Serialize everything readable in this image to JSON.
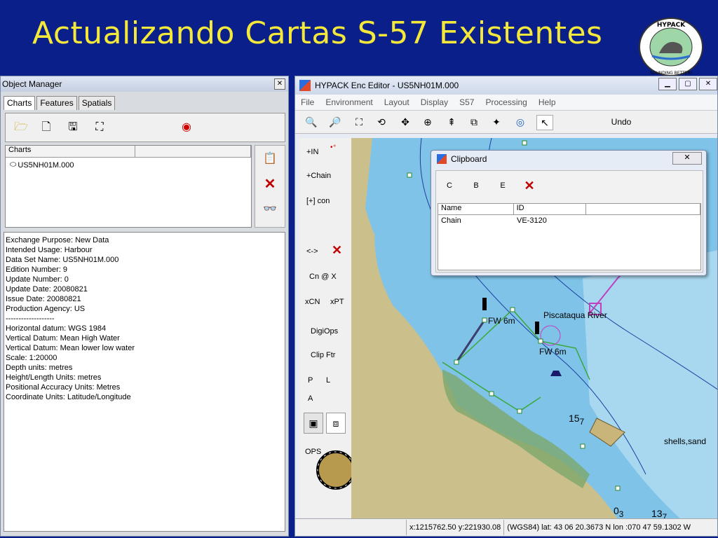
{
  "slide": {
    "title": "Actualizando Cartas S-57 Existentes",
    "logo_top": "HYPACK",
    "logo_bottom": "SOUNDING BETTER!"
  },
  "object_manager": {
    "title": "Object Manager",
    "tabs": [
      "Charts",
      "Features",
      "Spatials"
    ],
    "list_header": "Charts",
    "chart_item": "US5NH01M.000",
    "info_lines": [
      "Exchange Purpose: New Data",
      "Intended Usage: Harbour",
      "Data Set Name: US5NH01M.000",
      "Edition Number: 9",
      "Update Number: 0",
      "Update Date: 20080821",
      "Issue Date: 20080821",
      "Production Agency: US",
      "-------------------",
      "Horizontal datum: WGS 1984",
      "Vertical Datum: Mean High Water",
      "Vertical Datum: Mean lower low water",
      "Scale: 1:20000",
      "Depth units: metres",
      "Height/Length Units: metres",
      "Positional Accuracy Units: Metres",
      "Coordinate Units: Latitude/Longitude"
    ]
  },
  "editor": {
    "title": "HYPACK Enc Editor - US5NH01M.000",
    "menu": [
      "File",
      "Environment",
      "Layout",
      "Display",
      "S57",
      "Processing",
      "Help"
    ],
    "undo_label": "Undo",
    "left_tools": {
      "in": "+IN",
      "chain": "+Chain",
      "con": "[+] con",
      "arrows": "<->",
      "cn_x": "Cn @ X",
      "xcn": "xCN",
      "xpt": "xPT",
      "digiops": "DigiOps",
      "clip_ftr": "Clip Ftr",
      "p": "P",
      "l": "L",
      "a": "A",
      "ops": "OPS"
    },
    "status_xy": "x:1215762.50 y:221930.08",
    "status_geo": "(WGS84)  lat: 43 06 20.3673 N lon :070 47 59.1302 W"
  },
  "map_labels": {
    "river": "Piscataqua River",
    "shells": "shells,sand",
    "fw1": "FW 6m",
    "fw2": "FW 6m",
    "d1": "15",
    "d1s": "7",
    "d2": "0",
    "d2s": "3",
    "d3": "13",
    "d3s": "7"
  },
  "clipboard": {
    "title": "Clipboard",
    "buttons": [
      "C",
      "B",
      "E"
    ],
    "col_name": "Name",
    "col_id": "ID",
    "row_name": "Chain",
    "row_id": "VE-3120"
  },
  "colors": {
    "title": "#f4e83a",
    "background": "#0a1f8a",
    "land": "#cbbf8c",
    "water": "#7fc3e8",
    "deep_water": "#a8d8f0",
    "delete_red": "#c00000"
  }
}
